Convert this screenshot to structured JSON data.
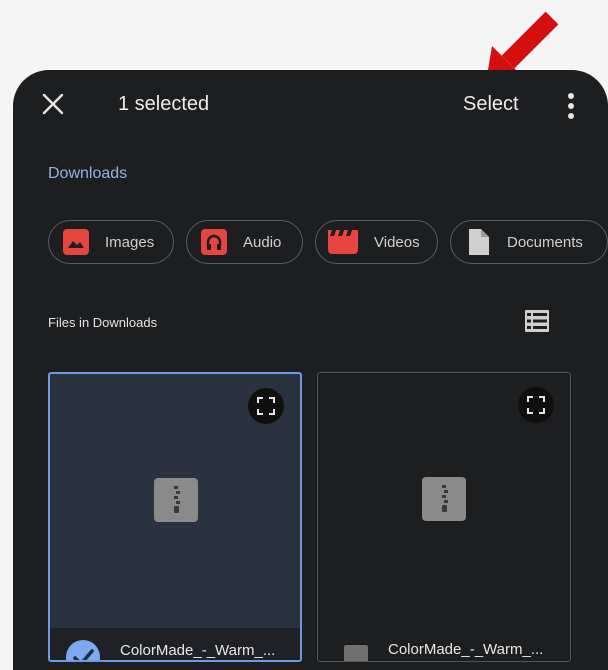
{
  "header": {
    "selected_count_label": "1 selected",
    "select_label": "Select"
  },
  "breadcrumb": {
    "label": "Downloads"
  },
  "filters": [
    {
      "label": "Images",
      "icon": "image-icon",
      "color": "#e5443f"
    },
    {
      "label": "Audio",
      "icon": "headphones-icon",
      "color": "#e5443f"
    },
    {
      "label": "Videos",
      "icon": "clapperboard-icon",
      "color": "#e5443f"
    },
    {
      "label": "Documents",
      "icon": "document-icon",
      "color": "#cfcfcf"
    }
  ],
  "section": {
    "title": "Files in Downloads"
  },
  "files": [
    {
      "name": "ColorMade_-_Warm_...",
      "selected": true
    },
    {
      "name": "ColorMade_-_Warm_...",
      "selected": false
    }
  ],
  "colors": {
    "accent": "#6f99e4",
    "link": "#8fb3e8",
    "background": "#1d1e20",
    "annotation_arrow": "#d40f0f"
  }
}
